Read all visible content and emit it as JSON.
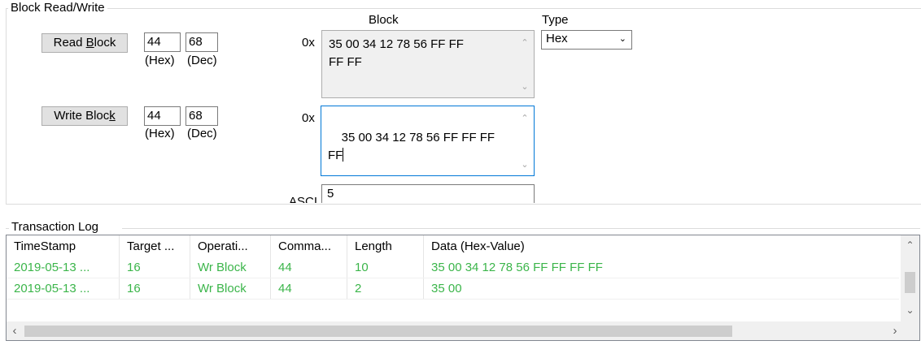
{
  "block_rw": {
    "title": "Block Read/Write",
    "block_header": "Block",
    "type_header": "Type",
    "read_button": "Read Block",
    "write_button": "Write Block",
    "read_hex_value": "44",
    "read_dec_value": "68",
    "write_hex_value": "44",
    "write_dec_value": "68",
    "hex_label": "(Hex)",
    "dec_label": "(Dec)",
    "read_prefix": "0x",
    "write_prefix": "0x",
    "read_data": "35 00 34 12 78 56 FF FF\nFF FF",
    "write_data": "35 00 34 12 78 56 FF FF FF\nFF",
    "ascii_label": "ASCII",
    "ascii_value": "5",
    "type_selected": "Hex"
  },
  "transaction_log": {
    "title": "Transaction Log",
    "columns": [
      "TimeStamp",
      "Target ...",
      "Operati...",
      "Comma...",
      "Length",
      "Data (Hex-Value)"
    ],
    "rows": [
      [
        "2019-05-13 ...",
        "16",
        "Wr Block",
        "44",
        "10",
        "35 00 34 12 78 56 FF FF FF FF"
      ],
      [
        "2019-05-13 ...",
        "16",
        "Wr Block",
        "44",
        "2",
        "35 00"
      ]
    ],
    "row_color": "#3bb54a"
  },
  "icons": {
    "scroll_up": "chevron-up-icon",
    "scroll_down": "chevron-down-icon",
    "scroll_left": "chevron-left-icon",
    "scroll_right": "chevron-right-icon",
    "dropdown": "chevron-down-icon"
  }
}
